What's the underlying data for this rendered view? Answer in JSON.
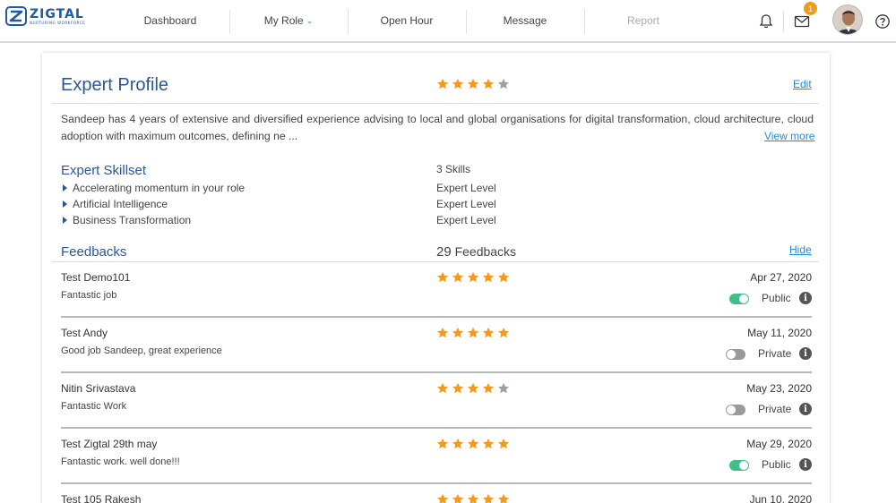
{
  "header": {
    "logo": {
      "name": "ZIGTAL",
      "tagline": "NURTURING WORKFORCE"
    },
    "nav": [
      {
        "label": "Dashboard",
        "disabled": false,
        "has_caret": false
      },
      {
        "label": "My Role",
        "disabled": false,
        "has_caret": true
      },
      {
        "label": "Open Hour",
        "disabled": false,
        "has_caret": false
      },
      {
        "label": "Message",
        "disabled": false,
        "has_caret": false
      },
      {
        "label": "Report",
        "disabled": true,
        "has_caret": false
      }
    ],
    "icons": {
      "notifications": "bell-icon",
      "messages": "mail-icon",
      "help": "help-icon"
    },
    "mail_badge": "1"
  },
  "profile": {
    "title": "Expert Profile",
    "rating": 4,
    "edit_label": "Edit",
    "about": "Sandeep has 4 years of extensive and diversified experience advising to local and global organisations for digital transformation, cloud architecture, cloud adoption with maximum outcomes, defining ne ...",
    "view_more_label": "View more"
  },
  "skillset": {
    "title": "Expert Skillset",
    "count": "3 Skills",
    "skills": [
      {
        "name": "Accelerating momentum in your role",
        "level": "Expert Level"
      },
      {
        "name": "Artificial Intelligence",
        "level": "Expert Level"
      },
      {
        "name": "Business Transformation",
        "level": "Expert Level"
      }
    ]
  },
  "feedbacks": {
    "title": "Feedbacks",
    "count": "29",
    "count_label": "Feedbacks",
    "hide_label": "Hide",
    "items": [
      {
        "name": "Test Demo101",
        "comment": "Fantastic job",
        "rating": 5,
        "date": "Apr 27, 2020",
        "visibility": "Public",
        "public": true
      },
      {
        "name": "Test Andy",
        "comment": "Good job Sandeep, great experience",
        "rating": 5,
        "date": "May 11, 2020",
        "visibility": "Private",
        "public": false
      },
      {
        "name": "Nitin Srivastava",
        "comment": "Fantastic Work",
        "rating": 4,
        "date": "May 23, 2020",
        "visibility": "Private",
        "public": false
      },
      {
        "name": "Test Zigtal 29th may",
        "comment": "Fantastic work. well done!!!",
        "rating": 5,
        "date": "May 29, 2020",
        "visibility": "Public",
        "public": true
      },
      {
        "name": "Test 105 Rakesh",
        "comment": "",
        "rating": 5,
        "date": "Jun 10, 2020",
        "visibility": "",
        "public": true
      }
    ]
  },
  "colors": {
    "star_filled": "#f39a1d",
    "star_empty": "#9aa0a6",
    "accent": "#2b5797",
    "link": "#1f8ad6",
    "toggle_on": "#3fbf8a",
    "toggle_off": "#9a9a9a"
  }
}
